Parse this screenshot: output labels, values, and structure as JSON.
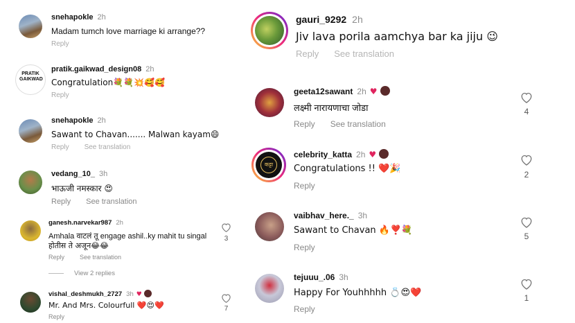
{
  "left": {
    "comments": [
      {
        "user": "snehapokle",
        "time": "2h",
        "text": "Madam tumch love marriage ki arrange??",
        "reply": "Reply",
        "see": ""
      },
      {
        "user": "pratik.gaikwad_design08",
        "time": "2h",
        "text": "Congratulation💐💐💥🥰🥰",
        "reply": "Reply",
        "see": "",
        "logo": "PRATIK GAIKWAD"
      },
      {
        "user": "snehapokle",
        "time": "2h",
        "text": "Sawant to Chavan....... Malwan kayam😄",
        "reply": "Reply",
        "see": "See translation"
      },
      {
        "user": "vedang_10_",
        "time": "3h",
        "text": "भाऊजी नमस्कार 😍",
        "reply": "Reply",
        "see": "See translation"
      },
      {
        "user": "ganesh.narvekar987",
        "time": "2h",
        "text": "Amhala वाटलं तू engage ashil..ky mahit tu singal",
        "text2": "होतीस ते अजून😂😂",
        "reply": "Reply",
        "see": "See translation",
        "likes": "3"
      },
      {
        "user": "vishal_deshmukh_2727",
        "time": "3h",
        "text": "Mr. And Mrs. Colourfull ❤️😍❤️",
        "reply": "Reply",
        "see": "",
        "likes": "7"
      }
    ],
    "view_replies": "View 2 replies"
  },
  "right": {
    "comments": [
      {
        "user": "gauri_9292",
        "time": "2h",
        "text": "Jiv lava porila aamchya bar ka jiju 😉",
        "reply": "Reply",
        "see": "See translation"
      },
      {
        "user": "geeta12sawant",
        "time": "2h",
        "text": "लक्ष्मी नारायणाचा जोडा",
        "reply": "Reply",
        "see": "See translation",
        "likes": "4"
      },
      {
        "user": "celebrity_katta",
        "time": "2h",
        "text": "Congratulations !! ❤️🎉",
        "reply": "Reply",
        "see": "",
        "likes": "2",
        "logo": "कट्टा"
      },
      {
        "user": "vaibhav_here._",
        "time": "3h",
        "text": "Sawant to Chavan 🔥❣️💐",
        "reply": "Reply",
        "see": "",
        "likes": "5"
      },
      {
        "user": "tejuuu_.06",
        "time": "3h",
        "text": "Happy For Youhhhhh 💍😍❤️",
        "reply": "Reply",
        "see": "",
        "likes": "1"
      }
    ]
  },
  "colors": {
    "accent_heart": "#e0245e",
    "meta": "#8e8e8e",
    "story_ring": "#d62976"
  }
}
